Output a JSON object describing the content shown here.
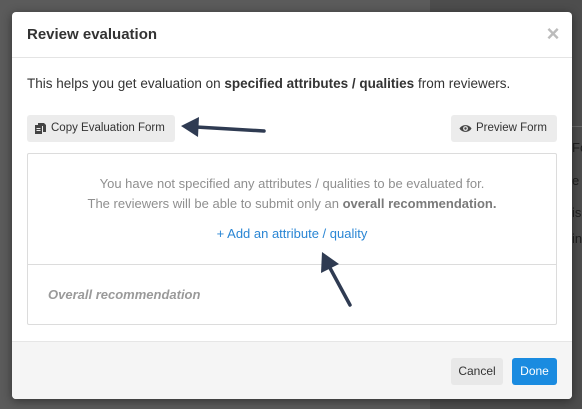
{
  "background": {
    "fragments": [
      "Fo",
      "e",
      "is",
      "in"
    ]
  },
  "modal": {
    "title": "Review evaluation",
    "close_label": "×",
    "description": {
      "prefix": "This helps you get evaluation on ",
      "bold": "specified attributes / qualities",
      "suffix": " from reviewers."
    },
    "toolbar": {
      "copy_label": "Copy Evaluation Form",
      "copy_icon": "document-copy-icon",
      "preview_label": "Preview Form",
      "preview_icon": "eye-icon"
    },
    "form": {
      "empty_line1": "You have not specified any attributes / qualities to be evaluated for.",
      "empty_line2_prefix": "The reviewers will be able to submit only an ",
      "empty_line2_bold": "overall recommendation.",
      "add_link": "+ Add an attribute / quality",
      "overall_label": "Overall recommendation"
    },
    "footer": {
      "cancel_label": "Cancel",
      "done_label": "Done"
    }
  },
  "colors": {
    "accent": "#1a8be0",
    "link": "#2a86d4",
    "annotation_arrow": "#2f3b52"
  }
}
